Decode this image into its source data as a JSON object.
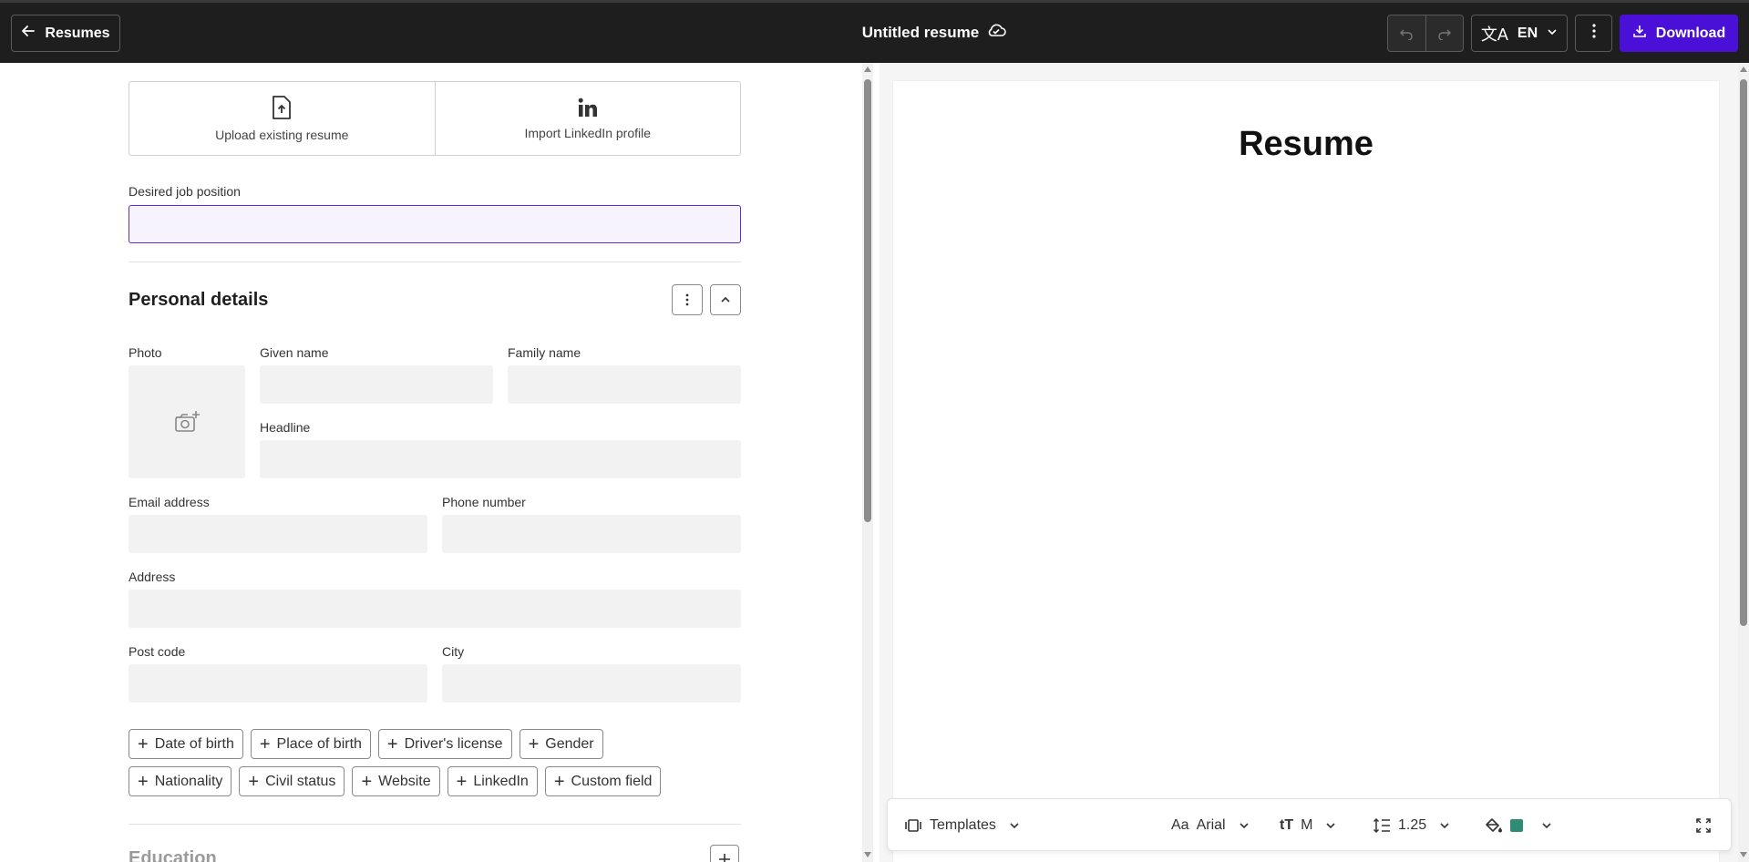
{
  "header": {
    "back_label": "Resumes",
    "doc_title": "Untitled resume",
    "language": "EN",
    "download_label": "Download"
  },
  "import": {
    "upload_label": "Upload existing resume",
    "linkedin_label": "Import LinkedIn profile"
  },
  "job": {
    "label": "Desired job position",
    "value": ""
  },
  "personal": {
    "title": "Personal details",
    "photo_label": "Photo",
    "given_name_label": "Given name",
    "family_name_label": "Family name",
    "headline_label": "Headline",
    "email_label": "Email address",
    "phone_label": "Phone number",
    "address_label": "Address",
    "post_code_label": "Post code",
    "city_label": "City",
    "chips_row1": [
      "Date of birth",
      "Place of birth",
      "Driver's license",
      "Gender"
    ],
    "chips_row2": [
      "Nationality",
      "Civil status",
      "Website",
      "LinkedIn",
      "Custom field"
    ]
  },
  "education": {
    "title": "Education"
  },
  "preview": {
    "title": "Resume"
  },
  "toolbar": {
    "templates_label": "Templates",
    "font_prefix": "Aa",
    "font": "Arial",
    "size_label": "M",
    "line_spacing": "1.25",
    "accent_color": "#2e8b74"
  },
  "colors": {
    "brand": "#4a10d8",
    "topbar": "#1e1e1e",
    "input_focus": "#5b2be0"
  }
}
